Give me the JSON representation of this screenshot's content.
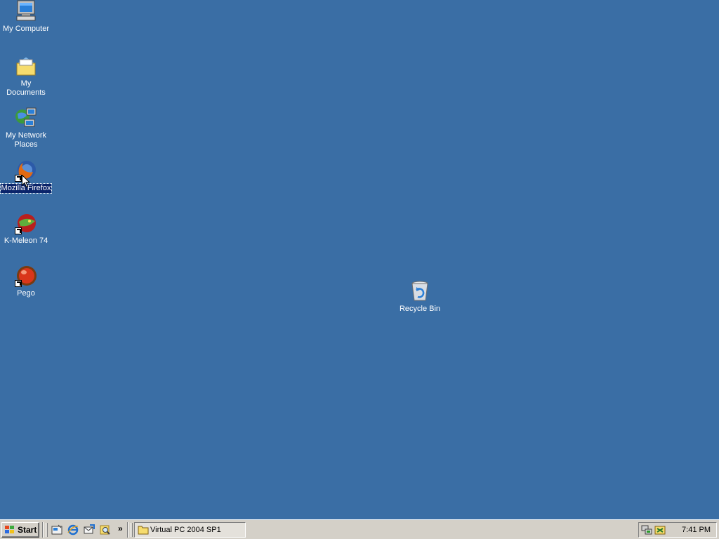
{
  "desktop": {
    "background": "#3a6ea5",
    "icons": [
      {
        "label": "My Computer",
        "icon": "my-computer-icon"
      },
      {
        "label": "My Documents",
        "icon": "my-documents-icon"
      },
      {
        "label": "My Network Places",
        "icon": "network-places-icon"
      },
      {
        "label": "Mozilla Firefox",
        "icon": "firefox-icon",
        "selected": true,
        "shortcut": true
      },
      {
        "label": "K-Meleon 74",
        "icon": "k-meleon-icon",
        "shortcut": true
      },
      {
        "label": "Pego",
        "icon": "pego-icon",
        "shortcut": true
      },
      {
        "label": "Recycle Bin",
        "icon": "recycle-bin-icon"
      }
    ]
  },
  "taskbar": {
    "start_label": "Start",
    "quick_launch": [
      "show-desktop-icon",
      "internet-explorer-icon",
      "outlook-express-icon",
      "search-icon"
    ],
    "quick_launch_more": "»",
    "tasks": [
      {
        "label": "Virtual PC 2004 SP1",
        "icon": "folder-icon"
      }
    ],
    "tray": {
      "icons": [
        "network-tray-icon",
        "virtual-machine-tray-icon"
      ],
      "clock": "7:41 PM"
    }
  }
}
